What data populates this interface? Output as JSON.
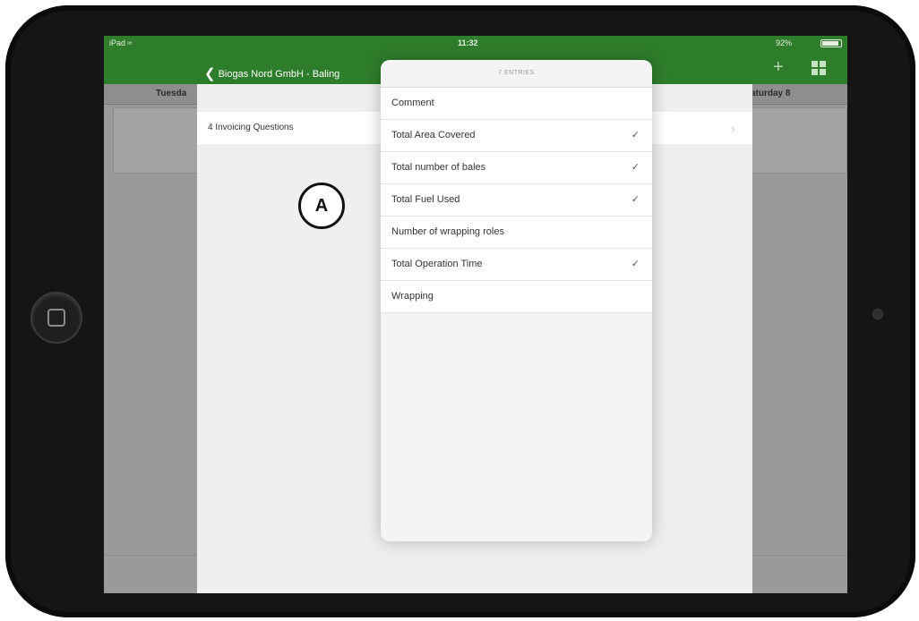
{
  "status": {
    "carrier": "iPad ≈",
    "time": "11:32",
    "battery": "92%",
    "battery_level": 0.92
  },
  "calendar": {
    "day_left": "Tuesda",
    "day_right": "aturday 8"
  },
  "sheet": {
    "back_label": "Biogas Nord GmbH - Baling",
    "question_row": "4 Invoicing Questions"
  },
  "popover": {
    "title": "7 ENTRIES",
    "items": [
      {
        "label": "Comment",
        "checked": false
      },
      {
        "label": "Total Area Covered",
        "checked": true
      },
      {
        "label": "Total number of bales",
        "checked": true
      },
      {
        "label": "Total Fuel Used",
        "checked": true
      },
      {
        "label": "Number of wrapping roles",
        "checked": false
      },
      {
        "label": "Total Operation Time",
        "checked": true
      },
      {
        "label": "Wrapping",
        "checked": false
      }
    ]
  },
  "annotation": {
    "label": "A"
  },
  "icons": {
    "plus": "+",
    "checkmark": "✓",
    "back_chevron": "❮",
    "row_chevron": "›"
  }
}
